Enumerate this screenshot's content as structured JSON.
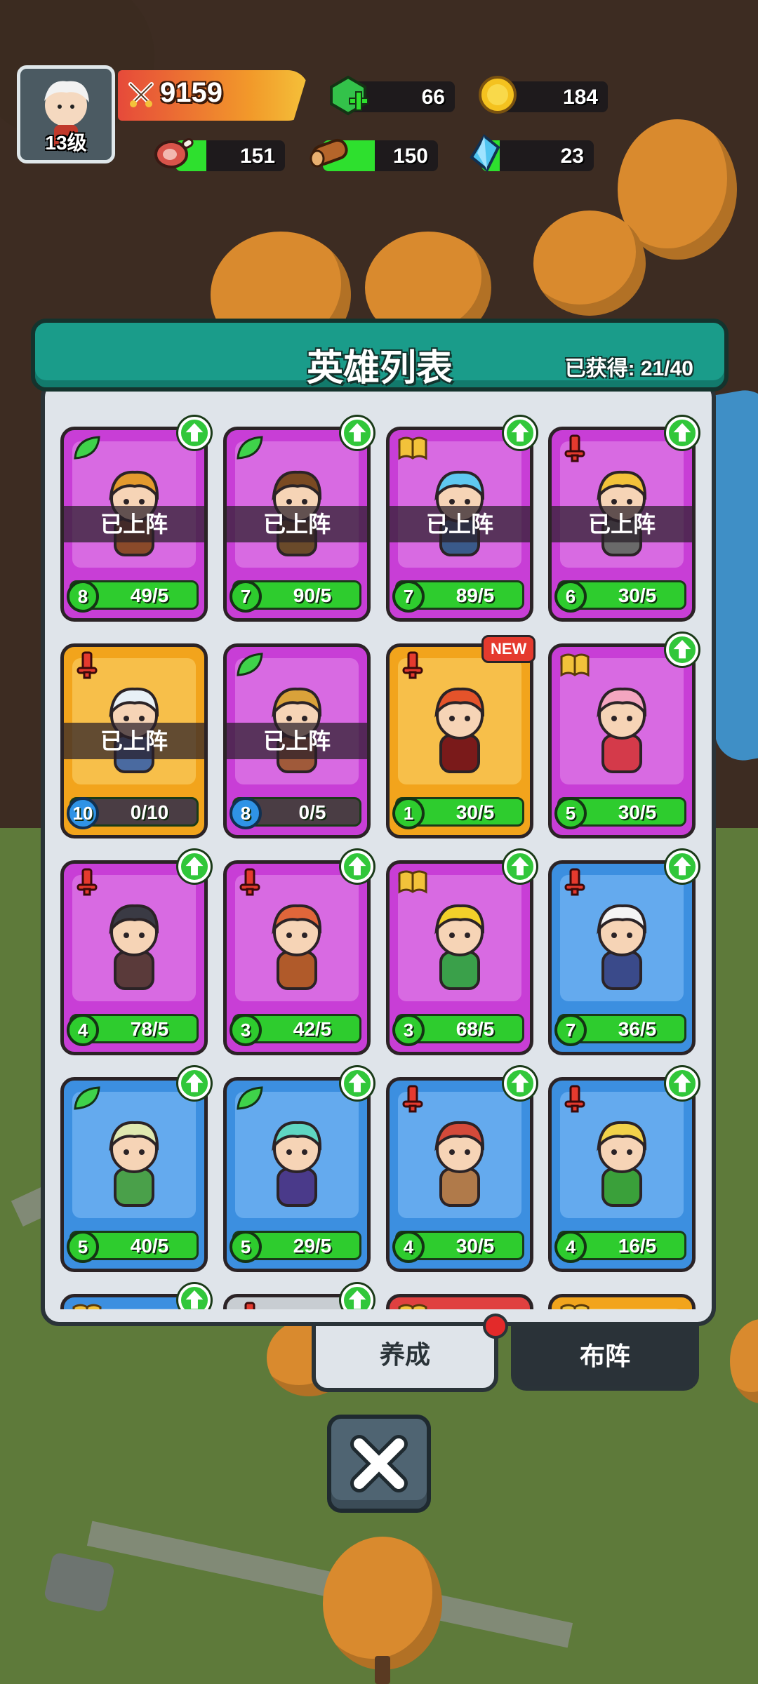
{
  "hud": {
    "avatar_level": "13级",
    "power": "9159",
    "gems": "66",
    "coins": "184",
    "meat": "151",
    "wood": "150",
    "crystal": "23",
    "meat_fill": 0.28,
    "wood_fill": 0.45,
    "crystal_fill": 0.16
  },
  "panel": {
    "title": "英雄列表",
    "owned_label": "已获得: 21/40"
  },
  "hero_cards": [
    {
      "color": "purple",
      "tag": "leaf",
      "arrow": "up",
      "level": "8",
      "count": "49/5",
      "deployed": "已上阵"
    },
    {
      "color": "purple",
      "tag": "leaf",
      "arrow": "up",
      "level": "7",
      "count": "90/5",
      "deployed": "已上阵"
    },
    {
      "color": "purple",
      "tag": "book",
      "arrow": "up",
      "level": "7",
      "count": "89/5",
      "deployed": "已上阵"
    },
    {
      "color": "purple",
      "tag": "sword",
      "arrow": "up",
      "level": "6",
      "count": "30/5",
      "deployed": "已上阵"
    },
    {
      "color": "orange",
      "tag": "sword",
      "arrow": "",
      "level": "10",
      "count": "0/10",
      "deployed": "已上阵",
      "level_style": "blue",
      "bar": "empty"
    },
    {
      "color": "purple",
      "tag": "leaf",
      "arrow": "",
      "level": "8",
      "count": "0/5",
      "deployed": "已上阵",
      "level_style": "blue",
      "bar": "empty"
    },
    {
      "color": "orange",
      "tag": "sword",
      "arrow": "",
      "level": "1",
      "count": "30/5",
      "deployed": "",
      "badge": "NEW"
    },
    {
      "color": "purple",
      "tag": "book",
      "arrow": "up",
      "level": "5",
      "count": "30/5",
      "deployed": ""
    },
    {
      "color": "purple",
      "tag": "sword",
      "arrow": "up",
      "level": "4",
      "count": "78/5",
      "deployed": ""
    },
    {
      "color": "purple",
      "tag": "sword",
      "arrow": "up",
      "level": "3",
      "count": "42/5",
      "deployed": ""
    },
    {
      "color": "purple",
      "tag": "book",
      "arrow": "up",
      "level": "3",
      "count": "68/5",
      "deployed": ""
    },
    {
      "color": "blue",
      "tag": "sword",
      "arrow": "up",
      "level": "7",
      "count": "36/5",
      "deployed": ""
    },
    {
      "color": "blue",
      "tag": "leaf",
      "arrow": "up",
      "level": "5",
      "count": "40/5",
      "deployed": ""
    },
    {
      "color": "blue",
      "tag": "leaf",
      "arrow": "up",
      "level": "5",
      "count": "29/5",
      "deployed": ""
    },
    {
      "color": "blue",
      "tag": "sword",
      "arrow": "up",
      "level": "4",
      "count": "30/5",
      "deployed": ""
    },
    {
      "color": "blue",
      "tag": "sword",
      "arrow": "up",
      "level": "4",
      "count": "16/5",
      "deployed": ""
    },
    {
      "color": "blue",
      "tag": "book",
      "arrow": "up",
      "level": "",
      "count": "",
      "deployed": "",
      "partial": true
    },
    {
      "color": "grey",
      "tag": "sword",
      "arrow": "up",
      "level": "",
      "count": "",
      "deployed": "",
      "partial": true
    },
    {
      "color": "red",
      "tag": "book",
      "arrow": "",
      "level": "",
      "count": "",
      "deployed": "",
      "partial": true
    },
    {
      "color": "orange",
      "tag": "book",
      "arrow": "",
      "level": "",
      "count": "",
      "deployed": "",
      "partial": true
    }
  ],
  "tabs": {
    "develop": "养成",
    "formation": "布阵"
  },
  "icons": {
    "close": "close-icon",
    "power": "crossed-swords-icon",
    "gem": "green-gem-plus-icon",
    "coin": "gold-coin-icon",
    "meat": "meat-icon",
    "wood": "wood-log-icon",
    "crystal": "blue-crystal-icon"
  },
  "colors": {
    "header_teal": "#1a9c8a",
    "card_purple": "#c83ed6",
    "card_orange": "#f2a41c",
    "card_blue": "#3c8fe0",
    "progress_green": "#2ecc2e"
  }
}
